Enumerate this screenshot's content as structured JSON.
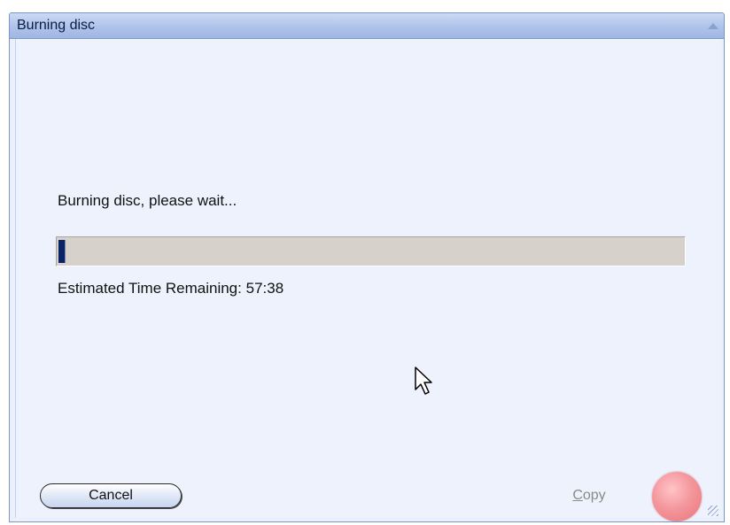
{
  "window": {
    "title": "Burning disc"
  },
  "content": {
    "status_message": "Burning disc, please wait...",
    "time_remaining_label": "Estimated Time Remaining:",
    "time_remaining_value": "57:38",
    "progress_fraction": 0.01
  },
  "buttons": {
    "cancel_label": "Cancel",
    "copy_label_accesskey": "C",
    "copy_label_rest": "opy"
  },
  "icons": {
    "titlebar_right": "chevron-up-icon",
    "action": "record-icon",
    "grip": "resize-grip-icon",
    "cursor": "mouse-pointer-icon"
  },
  "colors": {
    "window_bg": "#ebf0fb",
    "titlebar": "#aec3ea",
    "progress_track": "#d6d2cb",
    "progress_fill": "#0b2364",
    "record": "#f4979d",
    "disabled_text": "#8a8a8a"
  }
}
